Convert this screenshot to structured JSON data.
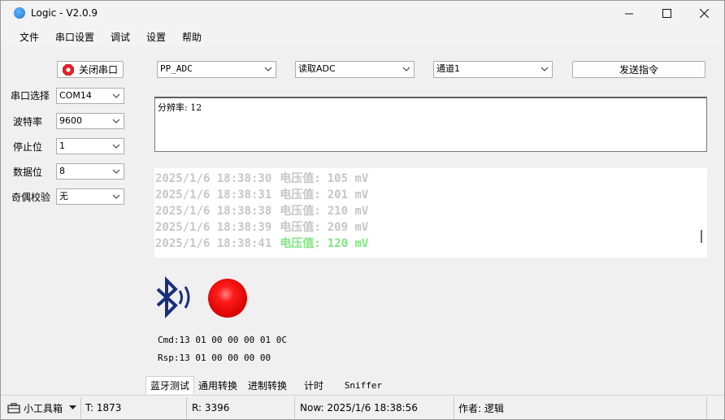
{
  "window": {
    "title": "Logic - V2.0.9"
  },
  "menu": [
    "文件",
    "串口设置",
    "调试",
    "设置",
    "帮助"
  ],
  "serial": {
    "close_port_label": "关闭串口",
    "port_label": "串口选择",
    "port_value": "COM14",
    "baud_label": "波特率",
    "baud_value": "9600",
    "stop_label": "停止位",
    "stop_value": "1",
    "data_label": "数据位",
    "data_value": "8",
    "parity_label": "奇偶校验",
    "parity_value": "无"
  },
  "toolbar": {
    "device_value": "PP_ADC",
    "command_value": "读取ADC",
    "channel_value": "通道1",
    "send_label": "发送指令"
  },
  "output_text": "分辨率: 12",
  "log": [
    {
      "time": "2025/1/6 18:38:30",
      "label": "电压值:",
      "value": "105 mV"
    },
    {
      "time": "2025/1/6 18:38:31",
      "label": "电压值:",
      "value": "201 mV"
    },
    {
      "time": "2025/1/6 18:38:38",
      "label": "电压值:",
      "value": "210 mV"
    },
    {
      "time": "2025/1/6 18:38:39",
      "label": "电压值:",
      "value": "209 mV"
    },
    {
      "time": "2025/1/6 18:38:41",
      "label": "电压值:",
      "value": "120 mV"
    }
  ],
  "colors": {
    "log_faded": "#c6c6c6",
    "log_highlight": "#7ee87e",
    "status_led": "#ee1111",
    "bluetooth": "#1a2f7a"
  },
  "icons": {
    "bluetooth": "bluetooth-icon",
    "led": "status-led-icon"
  },
  "cmd_text": "Cmd:13 01 00 00 00 01 0C",
  "rsp_text": "Rsp:13 01 00 00 00 00",
  "tabs": [
    "蓝牙测试",
    "通用转换",
    "进制转换",
    "计时",
    "Sniffer"
  ],
  "status": {
    "toolbox_label": "小工具箱",
    "t": "T: 1873",
    "r": "R: 3396",
    "now": "Now: 2025/1/6 18:38:56",
    "author": "作者: 逻辑"
  }
}
